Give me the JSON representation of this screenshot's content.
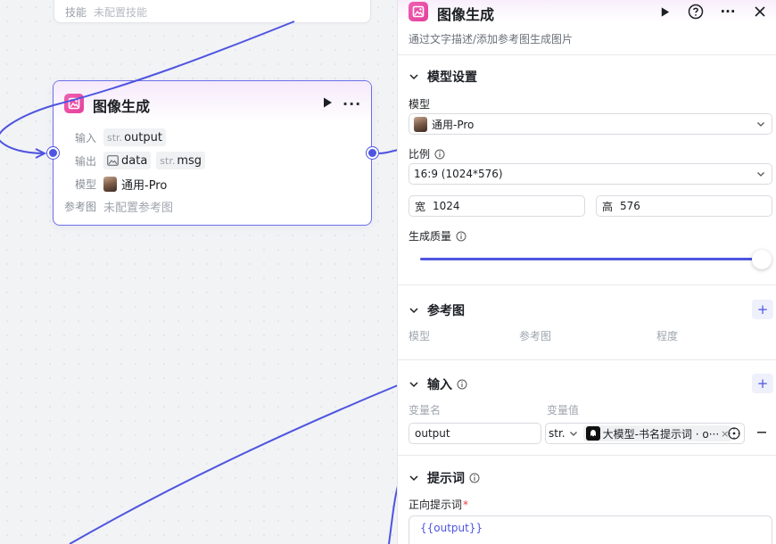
{
  "canvas": {
    "prev_node": {
      "label": "技能",
      "value": "未配置技能"
    },
    "node": {
      "title": "图像生成",
      "rows": {
        "input_label": "输入",
        "input_var": {
          "type": "str.",
          "name": "output"
        },
        "output_label": "输出",
        "output_vars": [
          {
            "type_icon": "image-icon",
            "name": "data"
          },
          {
            "type": "str.",
            "name": "msg"
          }
        ],
        "model_label": "模型",
        "model_value": "通用-Pro",
        "ref_label": "参考图",
        "ref_value": "未配置参考图"
      }
    }
  },
  "panel": {
    "title": "图像生成",
    "description": "通过文字描述/添加参考图生成图片",
    "model_settings": {
      "header": "模型设置",
      "model_label": "模型",
      "model_value": "通用-Pro",
      "ratio_label": "比例",
      "ratio_value": "16:9 (1024*576)",
      "width_prefix": "宽",
      "width_value": "1024",
      "height_prefix": "高",
      "height_value": "576",
      "quality_label": "生成质量",
      "quality_level": 1.0
    },
    "reference": {
      "header": "参考图",
      "columns": [
        "模型",
        "参考图",
        "程度"
      ]
    },
    "input": {
      "header": "输入",
      "columns": [
        "变量名",
        "变量值"
      ],
      "row": {
        "name": "output",
        "type": "str.",
        "value_tag": "大模型-书名提示词 · o···"
      }
    },
    "prompt": {
      "header": "提示词",
      "positive_label": "正向提示词",
      "required_mark": "*",
      "positive_value": "{{output}}"
    }
  },
  "colors": {
    "accent": "#4e55e0",
    "brand_pink": "#e43f9a"
  }
}
